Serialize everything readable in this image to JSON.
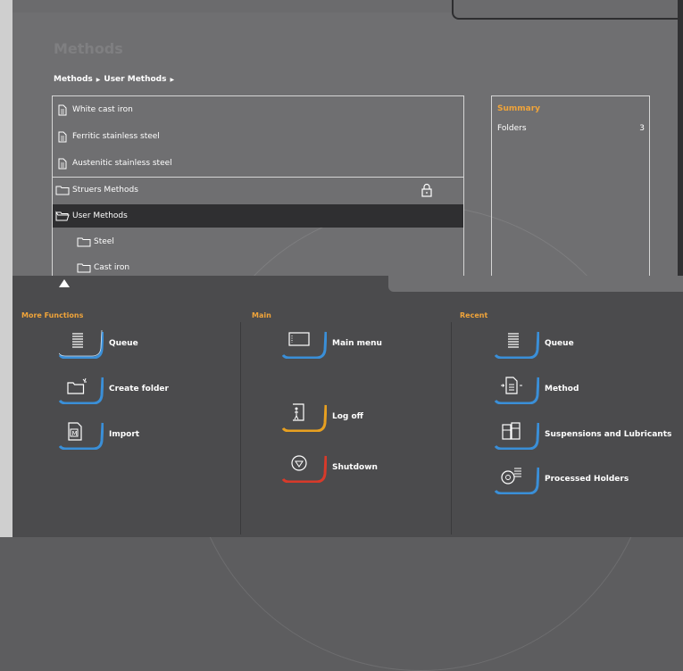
{
  "page": {
    "title": "Methods"
  },
  "breadcrumb": {
    "items": [
      "Methods",
      "User Methods"
    ]
  },
  "list": {
    "rows": [
      {
        "label": "White cast iron",
        "type": "file"
      },
      {
        "label": "Ferritic stainless steel",
        "type": "file"
      },
      {
        "label": "Austenitic stainless steel",
        "type": "file"
      },
      {
        "label": "Struers Methods",
        "type": "folder",
        "locked": true
      },
      {
        "label": "User Methods",
        "type": "folder-open",
        "selected": true
      },
      {
        "label": "Steel",
        "type": "folder"
      },
      {
        "label": "Cast iron",
        "type": "folder"
      }
    ]
  },
  "summary": {
    "title": "Summary",
    "folders_label": "Folders",
    "folders_value": "3"
  },
  "sections": {
    "more_functions": {
      "title": "More Functions",
      "items": [
        {
          "label": "Queue",
          "icon": "queue-icon",
          "accent": "#3a8fd8"
        },
        {
          "label": "Create folder",
          "icon": "create-folder-icon",
          "accent": "#3a8fd8"
        },
        {
          "label": "Import",
          "icon": "import-icon",
          "accent": "#3a8fd8"
        }
      ]
    },
    "main": {
      "title": "Main",
      "items": [
        {
          "label": "Main menu",
          "icon": "main-menu-icon",
          "accent": "#3a8fd8"
        },
        {
          "label": "Log off",
          "icon": "log-off-icon",
          "accent": "#e8a020"
        },
        {
          "label": "Shutdown",
          "icon": "shutdown-icon",
          "accent": "#d83a2a"
        }
      ]
    },
    "recent": {
      "title": "Recent",
      "items": [
        {
          "label": "Queue",
          "icon": "queue-icon",
          "accent": "#3a8fd8"
        },
        {
          "label": "Method",
          "icon": "method-icon",
          "accent": "#3a8fd8"
        },
        {
          "label": "Suspensions and Lubricants",
          "icon": "suspensions-icon",
          "accent": "#3a8fd8"
        },
        {
          "label": "Processed Holders",
          "icon": "processed-holders-icon",
          "accent": "#3a8fd8"
        }
      ]
    }
  },
  "colors": {
    "accent_orange": "#f0a43a",
    "blue": "#3a8fd8",
    "yellow": "#e8a020",
    "red": "#d83a2a"
  }
}
